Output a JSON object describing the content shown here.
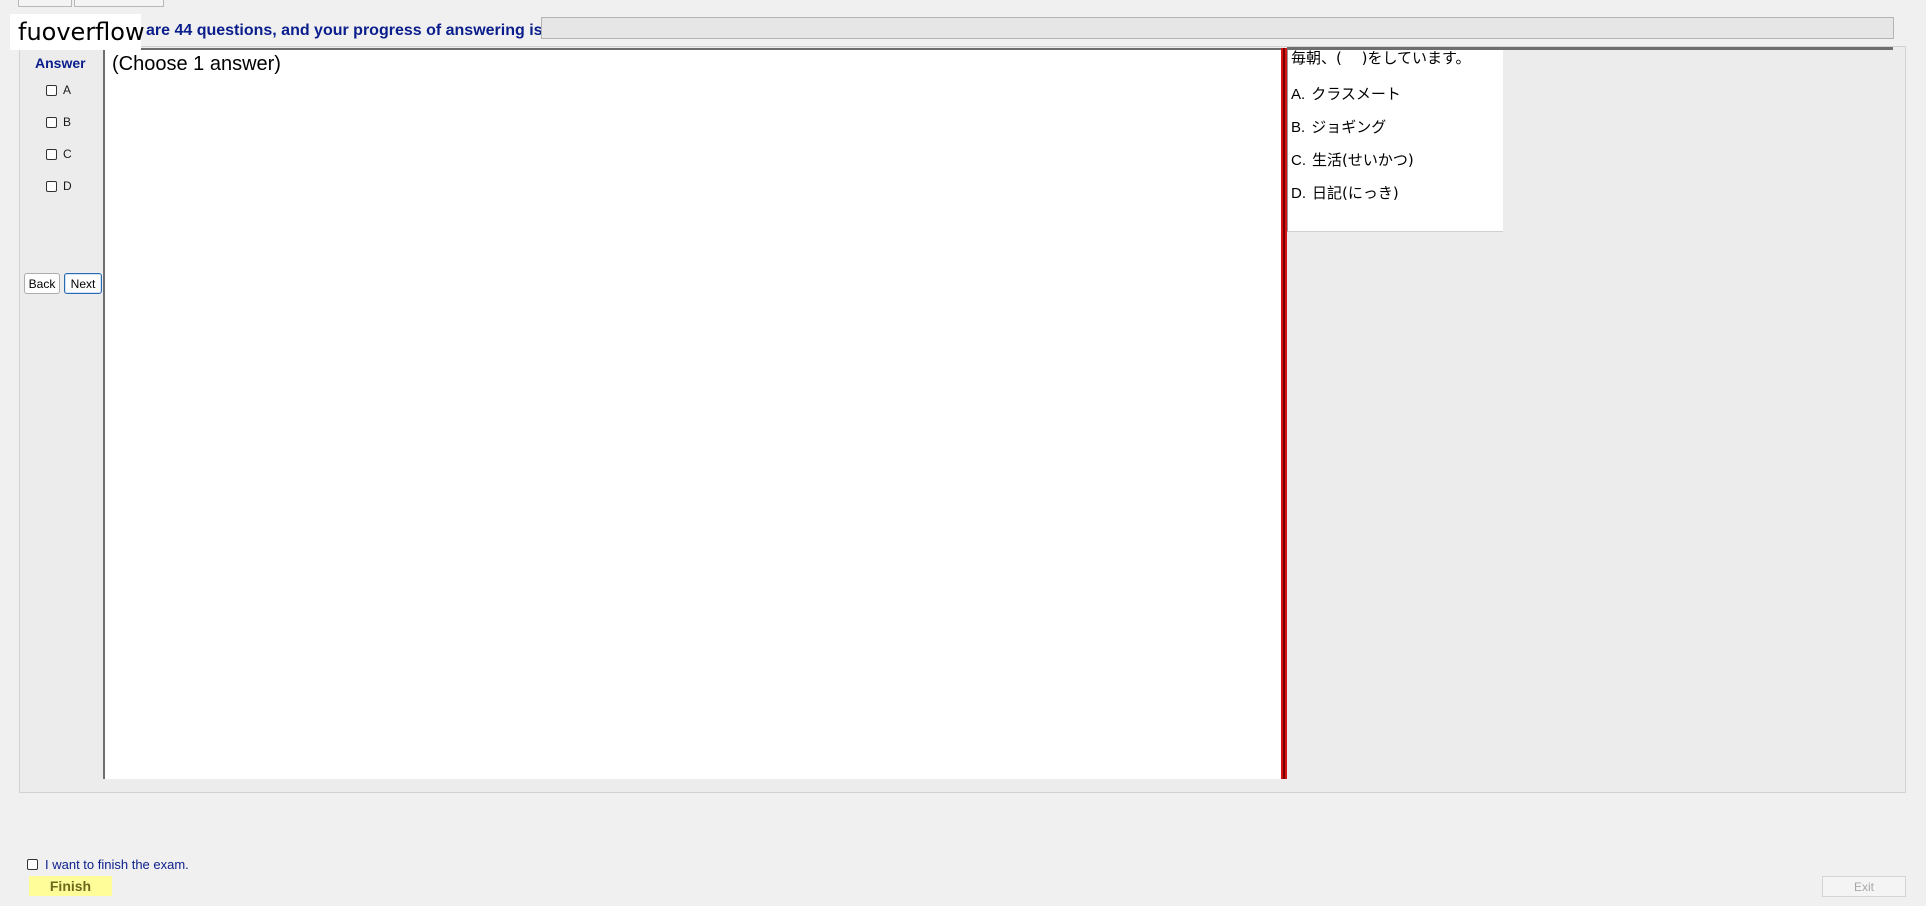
{
  "header": {
    "watermark": "fuoverflow",
    "progress_text": "are 44 questions, and your progress of answering is",
    "progress_fraction": 0
  },
  "sidebar": {
    "answer_label": "Answer",
    "options": [
      "A",
      "B",
      "C",
      "D"
    ],
    "back_label": "Back",
    "next_label": "Next"
  },
  "question": {
    "instruction": "(Choose 1 answer)",
    "stem": "毎朝、(　 )をしています。",
    "choices": [
      {
        "letter": "A.",
        "text": "クラスメート"
      },
      {
        "letter": "B.",
        "text": "ジョギング"
      },
      {
        "letter": "C.",
        "text": "生活(せいかつ)"
      },
      {
        "letter": "D.",
        "text": "日記(にっき)"
      }
    ]
  },
  "footer": {
    "finish_checkbox_label": "I want to finish the exam.",
    "finish_label": "Finish",
    "exit_label": "Exit"
  },
  "colors": {
    "label_blue": "#0a1e8c",
    "divider_red": "#d21414",
    "finish_yellow": "#fffd9a"
  }
}
